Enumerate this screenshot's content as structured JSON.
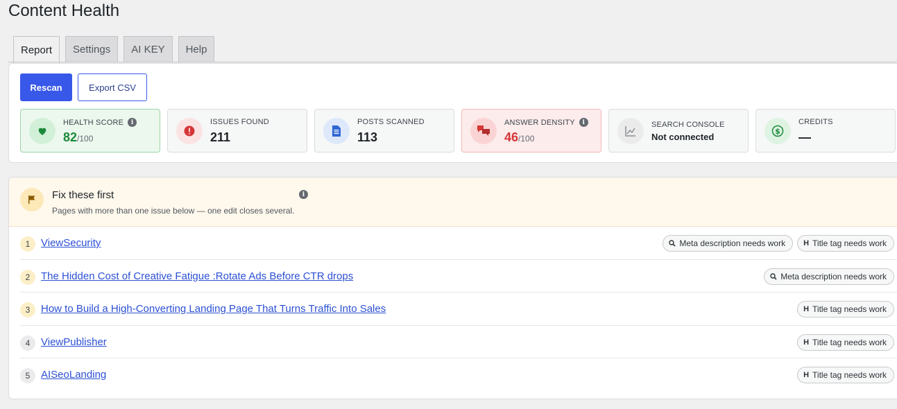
{
  "page": {
    "title": "Content Health"
  },
  "tabs": [
    {
      "label": "Report",
      "active": true
    },
    {
      "label": "Settings",
      "active": false
    },
    {
      "label": "AI KEY",
      "active": false
    },
    {
      "label": "Help",
      "active": false
    }
  ],
  "actions": {
    "rescan": "Rescan",
    "export": "Export CSV"
  },
  "stats": {
    "health": {
      "label": "HEALTH SCORE",
      "value": "82",
      "suffix": "/100",
      "color": "#1a8a3a",
      "icon": "heart-icon"
    },
    "issues": {
      "label": "ISSUES FOUND",
      "value": "211",
      "icon": "alert-icon"
    },
    "posts": {
      "label": "POSTS SCANNED",
      "value": "113",
      "icon": "document-icon"
    },
    "density": {
      "label": "ANSWER DENSITY",
      "value": "46",
      "suffix": "/100",
      "color": "#d63638",
      "icon": "chat-bubbles-icon"
    },
    "console": {
      "label": "SEARCH CONSOLE",
      "value": "Not connected",
      "icon": "chart-line-icon"
    },
    "credits": {
      "label": "CREDITS",
      "value": "—",
      "icon": "dollar-icon"
    }
  },
  "fix": {
    "title": "Fix these first",
    "subtitle": "Pages with more than one issue below — one edit closes several.",
    "rows": [
      {
        "num": "1",
        "title": "ViewSecurity",
        "chips": [
          "Meta description needs work",
          "Title tag needs work"
        ]
      },
      {
        "num": "2",
        "title": "The Hidden Cost of Creative Fatigue :Rotate Ads Before CTR drops",
        "chips": [
          "Meta description needs work"
        ]
      },
      {
        "num": "3",
        "title": "How to Build a High-Converting Landing Page That Turns Traffic Into Sales",
        "chips": [
          "Title tag needs work"
        ]
      },
      {
        "num": "4",
        "title": "ViewPublisher",
        "chips": [
          "Title tag needs work"
        ]
      },
      {
        "num": "5",
        "title": "AISeoLanding",
        "chips": [
          "Title tag needs work"
        ]
      }
    ]
  }
}
